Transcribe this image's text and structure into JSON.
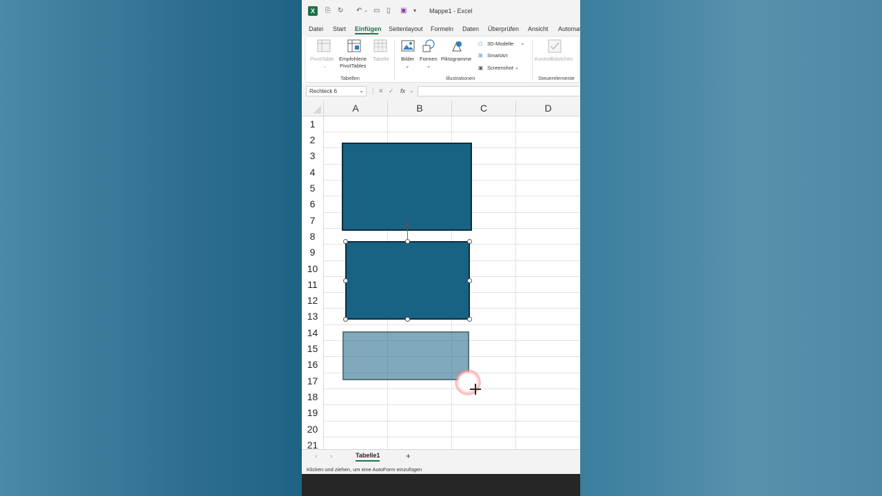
{
  "titlebar": {
    "title": "Mappe1 - Excel",
    "logo": "X"
  },
  "menu": {
    "tabs": [
      "Datei",
      "Start",
      "Einfügen",
      "Seitenlayout",
      "Formeln",
      "Daten",
      "Überprüfen",
      "Ansicht",
      "Automat"
    ],
    "active": "Einfügen"
  },
  "ribbon": {
    "pivottable": "PivotTable",
    "empfohlene_line1": "Empfohlene",
    "empfohlene_line2": "PivotTables",
    "tabelle": "Tabelle",
    "bilder": "Bilder",
    "formen": "Formen",
    "piktogramme": "Piktogramme",
    "modelle_3d": "3D-Modelle",
    "smartart": "SmartArt",
    "screenshot": "Screenshot",
    "kontrollkaestchen": "Kontrollkästchen",
    "group_tabellen": "Tabellen",
    "group_illustrationen": "Illustrationen",
    "group_steuerelemente": "Steuerelemente"
  },
  "formula_bar": {
    "name_box": "Rechteck 6",
    "fx": "fx",
    "value": ""
  },
  "grid": {
    "columns": [
      "A",
      "B",
      "C",
      "D"
    ],
    "rows": [
      "1",
      "2",
      "3",
      "4",
      "5",
      "6",
      "7",
      "8",
      "9",
      "10",
      "11",
      "12",
      "13",
      "14",
      "15",
      "16",
      "17",
      "18",
      "19",
      "20",
      "21"
    ]
  },
  "sheets": {
    "active": "Tabelle1",
    "add": "+"
  },
  "status": {
    "text": "Klicken und ziehen, um eine AutoForm einzufügen"
  },
  "colors": {
    "accent": "#1e7145",
    "shape_fill": "#186283",
    "shape_border": "#0b2d3d"
  }
}
